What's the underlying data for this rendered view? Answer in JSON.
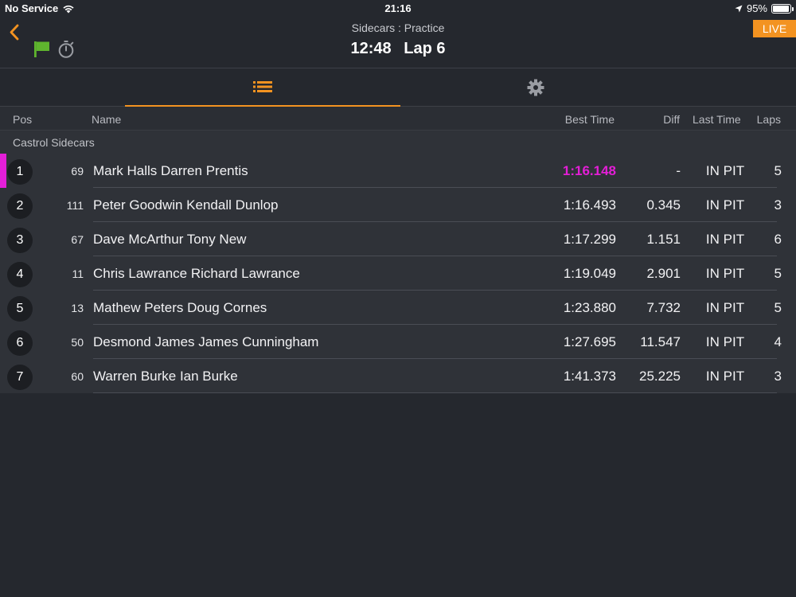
{
  "status_bar": {
    "carrier": "No Service",
    "time": "21:16",
    "battery": "95%",
    "battery_level": 0.95
  },
  "header": {
    "subtitle": "Sidecars : Practice",
    "clock": "12:48",
    "lap": "Lap 6",
    "live_label": "LIVE"
  },
  "icons": {
    "back": "chevron-left-icon",
    "flag": "green-flag-icon",
    "timer": "stopwatch-icon",
    "list": "list-icon",
    "settings": "gear-icon"
  },
  "colors": {
    "accent": "#f39321",
    "fastest": "#e31ed6",
    "flag": "#5fb52e"
  },
  "columns": {
    "pos": "Pos",
    "name": "Name",
    "best": "Best Time",
    "diff": "Diff",
    "last": "Last Time",
    "laps": "Laps"
  },
  "group": "Castrol Sidecars",
  "rows": [
    {
      "pos": "1",
      "num": "69",
      "name": "Mark Halls Darren Prentis",
      "best": "1:16.148",
      "diff": "-",
      "last": "IN PIT",
      "laps": "5"
    },
    {
      "pos": "2",
      "num": "111",
      "name": "Peter Goodwin Kendall Dunlop",
      "best": "1:16.493",
      "diff": "0.345",
      "last": "IN PIT",
      "laps": "3"
    },
    {
      "pos": "3",
      "num": "67",
      "name": "Dave McArthur Tony New",
      "best": "1:17.299",
      "diff": "1.151",
      "last": "IN PIT",
      "laps": "6"
    },
    {
      "pos": "4",
      "num": "11",
      "name": "Chris Lawrance Richard Lawrance",
      "best": "1:19.049",
      "diff": "2.901",
      "last": "IN PIT",
      "laps": "5"
    },
    {
      "pos": "5",
      "num": "13",
      "name": "Mathew Peters Doug Cornes",
      "best": "1:23.880",
      "diff": "7.732",
      "last": "IN PIT",
      "laps": "5"
    },
    {
      "pos": "6",
      "num": "50",
      "name": "Desmond James James Cunningham",
      "best": "1:27.695",
      "diff": "11.547",
      "last": "IN PIT",
      "laps": "4"
    },
    {
      "pos": "7",
      "num": "60",
      "name": "Warren Burke Ian Burke",
      "best": "1:41.373",
      "diff": "25.225",
      "last": "IN PIT",
      "laps": "3"
    }
  ]
}
